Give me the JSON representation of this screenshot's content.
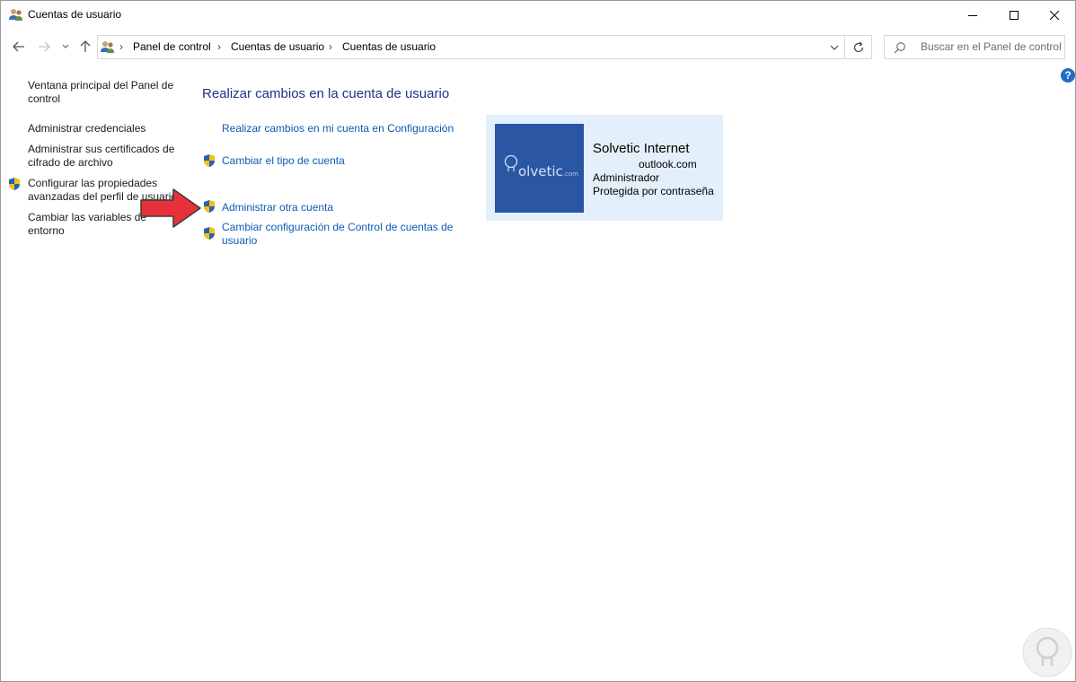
{
  "window": {
    "title": "Cuentas de usuario"
  },
  "address": {
    "crumbs": [
      "Panel de control",
      "Cuentas de usuario",
      "Cuentas de usuario"
    ],
    "search_placeholder": "Buscar en el Panel de control"
  },
  "sidebar": {
    "items": [
      {
        "label": "Ventana principal del Panel de control",
        "shield": false
      },
      {
        "label": "Administrar credenciales",
        "shield": false
      },
      {
        "label": "Administrar sus certificados de cifrado de archivo",
        "shield": false
      },
      {
        "label": "Configurar las propiedades avanzadas del perfil de usuario",
        "shield": true
      },
      {
        "label": "Cambiar las variables de entorno",
        "shield": false
      }
    ]
  },
  "main": {
    "heading": "Realizar cambios en la cuenta de usuario",
    "tasks": [
      {
        "label": "Realizar cambios en mi cuenta en Configuración",
        "shield": false
      },
      {
        "label": "Cambiar el tipo de cuenta",
        "shield": true
      },
      {
        "label": "Administrar otra cuenta",
        "shield": true
      },
      {
        "label": "Cambiar configuración de Control de cuentas de usuario",
        "shield": true
      }
    ]
  },
  "account": {
    "name": "Solvetic Internet",
    "email": "outlook.com",
    "role": "Administrador",
    "protection": "Protegida por contraseña",
    "picture_text": "olvetic",
    "picture_suffix": ".com"
  },
  "colors": {
    "link": "#0b5bb5",
    "heading": "#1e3287",
    "card_bg": "#e3f0fb",
    "picture_bg": "#2b56a3",
    "annotation_arrow": "#e8303a"
  },
  "icons": [
    "user-accounts-icon",
    "back-arrow-icon",
    "forward-arrow-icon",
    "recent-locations-icon",
    "up-arrow-icon",
    "chevron-right-icon",
    "dropdown-icon",
    "refresh-icon",
    "search-icon",
    "help-icon",
    "uac-shield-icon",
    "red-arrow-annotation",
    "solvetic-watermark-icon"
  ]
}
